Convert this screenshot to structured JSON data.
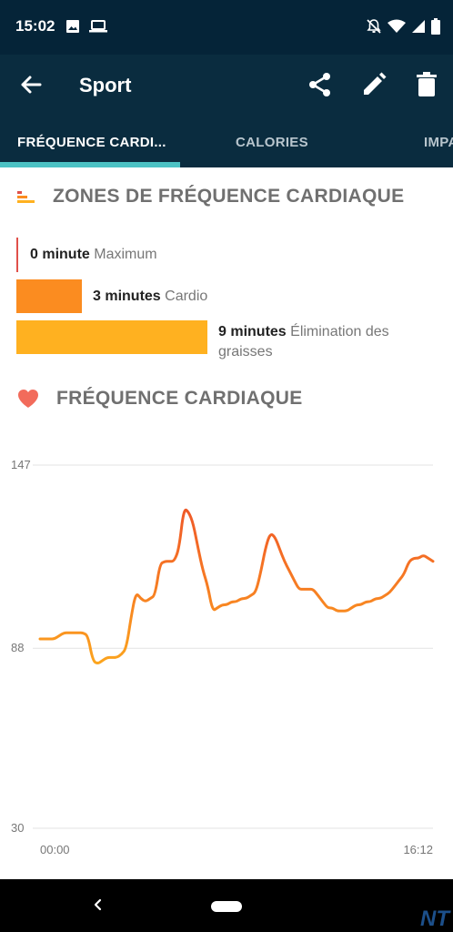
{
  "status_bar": {
    "time": "15:02"
  },
  "app_bar": {
    "title": "Sport"
  },
  "tabs": [
    {
      "label": "FRÉQUENCE CARDI...",
      "active": true
    },
    {
      "label": "CALORIES",
      "active": false
    },
    {
      "label": "IMPA",
      "active": false
    }
  ],
  "zones_section": {
    "title": "ZONES DE FRÉQUENCE CARDIAQUE",
    "zones": [
      {
        "value": "0 minute",
        "name": "Maximum",
        "color": "#e0504a",
        "minutes": 0
      },
      {
        "value": "3 minutes",
        "name": "Cardio",
        "color": "#fb8c20",
        "minutes": 3
      },
      {
        "value": "9 minutes",
        "name": "Élimination des graisses",
        "name_line1": "Élimination des",
        "name_line2": "graisses",
        "color": "#ffb120",
        "minutes": 9
      }
    ]
  },
  "heart_section": {
    "title": "FRÉQUENCE CARDIAQUE"
  },
  "chart_data": {
    "type": "line",
    "title": "FRÉQUENCE CARDIAQUE",
    "xlabel": "",
    "ylabel": "",
    "x_tick_labels": [
      "00:00",
      "16:12"
    ],
    "y_tick_labels": [
      "147",
      "88",
      "30"
    ],
    "ylim": [
      30,
      147
    ],
    "grid": true,
    "series": [
      {
        "values": [
          91,
          91,
          91,
          91,
          92,
          93,
          93,
          93,
          93,
          93,
          92,
          84,
          83,
          84,
          85,
          85,
          85,
          86,
          88,
          98,
          106,
          104,
          103,
          104,
          105,
          115,
          116,
          116,
          116,
          120,
          133,
          132,
          128,
          120,
          113,
          108,
          100,
          101,
          102,
          102,
          103,
          103,
          104,
          104,
          105,
          106,
          112,
          120,
          125,
          124,
          120,
          116,
          113,
          110,
          107,
          107,
          107,
          107,
          105,
          103,
          101,
          101,
          100,
          100,
          100,
          101,
          102,
          102,
          103,
          103,
          104,
          104,
          105,
          106,
          108,
          110,
          112,
          116,
          117,
          117,
          118,
          117,
          116
        ]
      }
    ]
  }
}
